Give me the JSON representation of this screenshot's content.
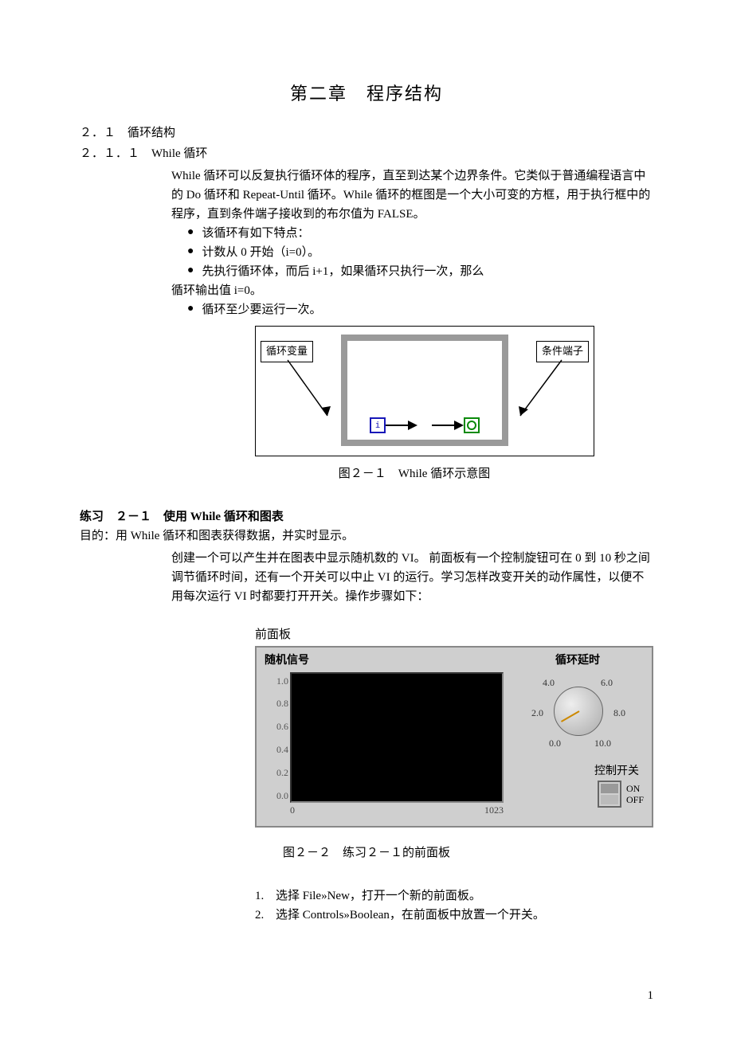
{
  "title": "第二章　程序结构",
  "sec1": "２．１　循环结构",
  "sec11": "２．１．１　While 循环",
  "p1": "While 循环可以反复执行循环体的程序，直至到达某个边界条件。它类似于普通编程语言中的 Do 循环和 Repeat-Until 循环。While 循环的框图是一个大小可变的方框，用于执行框中的程序，直到条件端子接收到的布尔值为 FALSE。",
  "bullets": {
    "b1": "该循环有如下特点：",
    "b2": "计数从 0 开始（i=0）。",
    "b3": "先执行循环体，而后 i+1，如果循环只执行一次，那么",
    "b3b": "循环输出值 i=0。",
    "b4": "循环至少要运行一次。"
  },
  "fig1": {
    "left_label": "循环变量",
    "right_label": "条件端子",
    "i": "i",
    "caption": "图２－１　While 循环示意图"
  },
  "ex_heading": "练习　２－１　使用 While 循环和图表",
  "ex_goal": "目的：用 While 循环和图表获得数据，并实时显示。",
  "ex_para": "创建一个可以产生并在图表中显示随机数的 VI。 前面板有一个控制旋钮可在 0 到 10 秒之间调节循环时间，还有一个开关可以中止 VI 的运行。学习怎样改变开关的动作属性，以便不用每次运行 VI 时都要打开开关。操作步骤如下：",
  "panel": {
    "outer_title": "前面板",
    "chart_title": "随机信号",
    "yticks": [
      "1.0",
      "0.8",
      "0.6",
      "0.4",
      "0.2",
      "0.0"
    ],
    "xticks": [
      "0",
      "1023"
    ],
    "dial_title": "循环延时",
    "dial_labels": {
      "t0": "0.0",
      "t2": "2.0",
      "t4": "4.0",
      "t6": "6.0",
      "t8": "8.0",
      "t10": "10.0"
    },
    "switch_title": "控制开关",
    "on": "ON",
    "off": "OFF"
  },
  "fig2_caption": "图２－２　练习２－１的前面板",
  "steps": {
    "s1n": "1.",
    "s1": "选择 File»New，打开一个新的前面板。",
    "s2n": "2.",
    "s2": "选择 Controls»Boolean，在前面板中放置一个开关。"
  },
  "page_number": "1",
  "chart_data": {
    "type": "line",
    "title": "随机信号",
    "xlabel": "",
    "ylabel": "",
    "xlim": [
      0,
      1023
    ],
    "ylim": [
      0.0,
      1.0
    ],
    "yticks": [
      0.0,
      0.2,
      0.4,
      0.6,
      0.8,
      1.0
    ],
    "xticks": [
      0,
      1023
    ],
    "series": [
      {
        "name": "随机信号",
        "values": []
      }
    ],
    "note": "Chart area is empty (black) in the screenshot; no data points plotted."
  }
}
